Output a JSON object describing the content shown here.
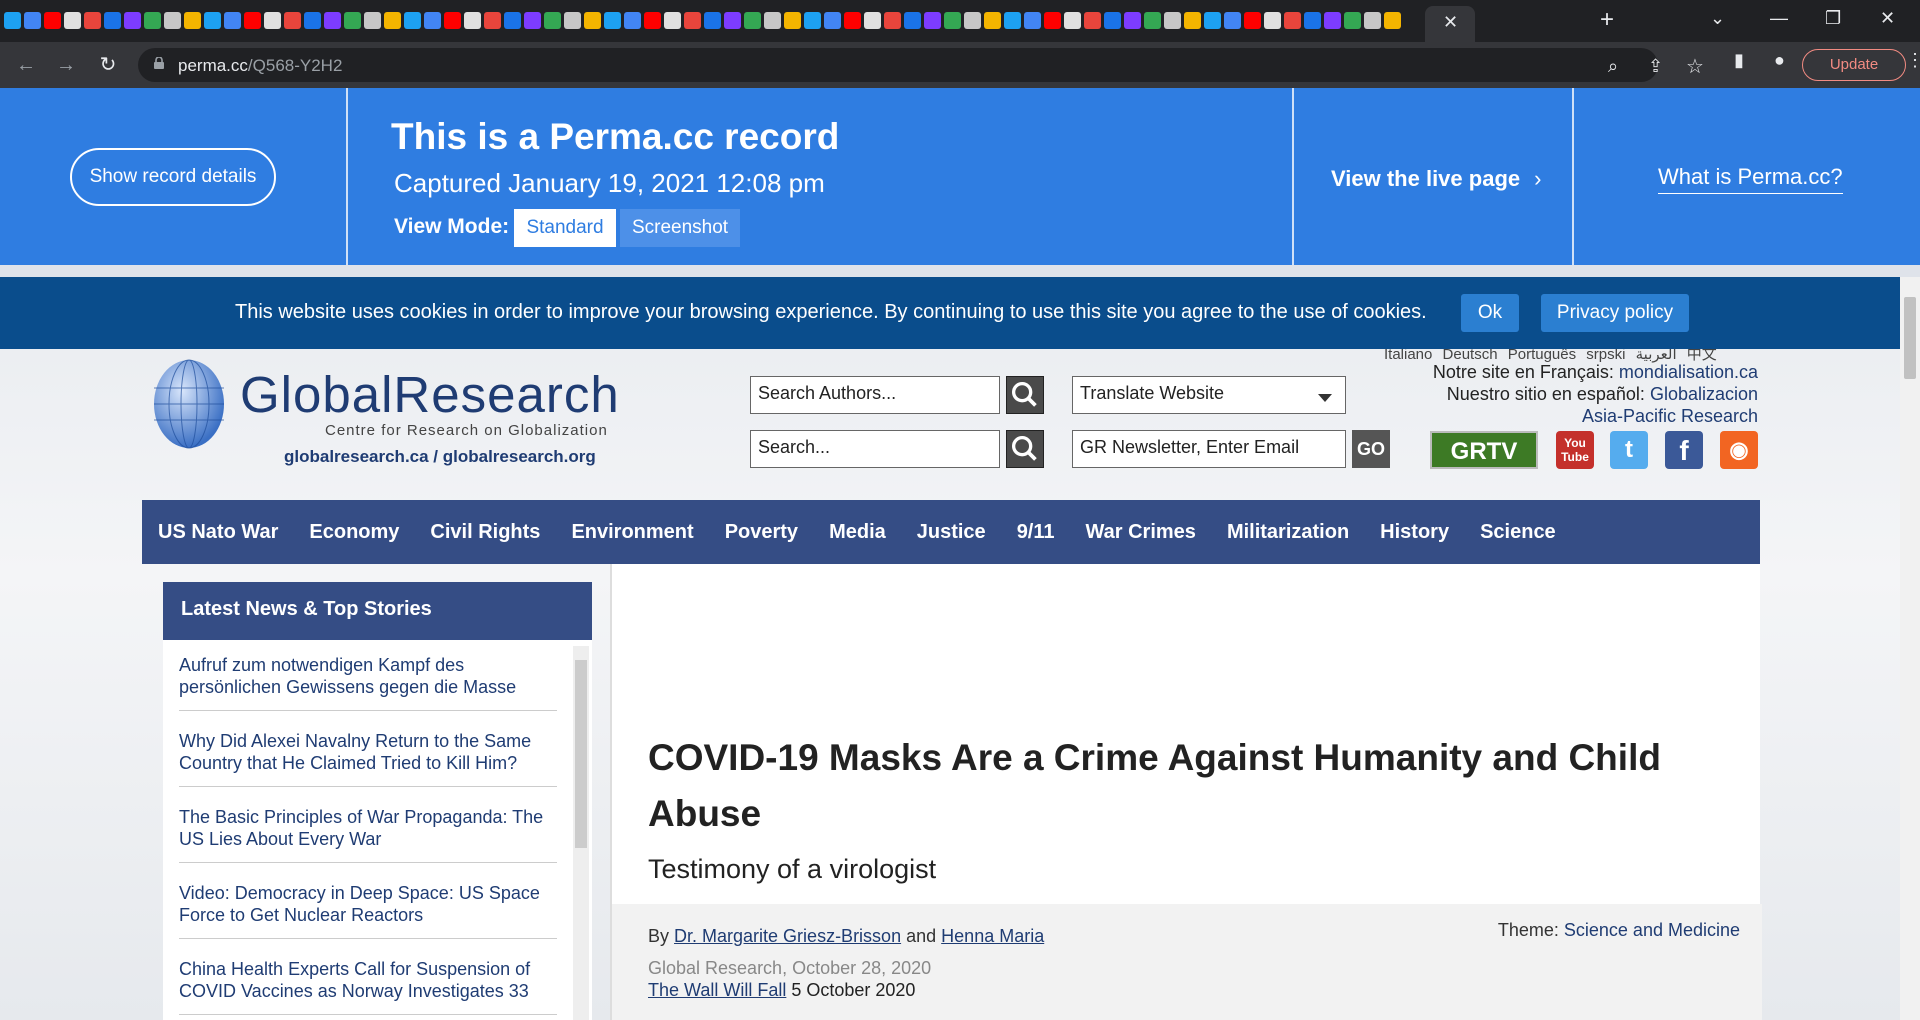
{
  "browser": {
    "url_host": "perma.cc",
    "url_path": "/Q568-Y2H2",
    "update_label": "Update"
  },
  "perma": {
    "show_details": "Show record details",
    "title": "This is a Perma.cc record",
    "captured": "Captured January 19, 2021 12:08 pm",
    "view_mode_label": "View Mode:",
    "mode_standard": "Standard",
    "mode_screenshot": "Screenshot",
    "live_page": "View the live page",
    "what_is": "What is Perma.cc?"
  },
  "cookie": {
    "text": "This website uses cookies in order to improve your browsing experience. By continuing to use this site you agree to the use of cookies.",
    "ok": "Ok",
    "privacy": "Privacy policy"
  },
  "site": {
    "languages": "Italiano  Deutsch  Português  srpski  العربية  中文",
    "logo_word": "GlobalResearch",
    "logo_sub": "Centre for Research on Globalization",
    "logo_url": "globalresearch.ca / globalresearch.org",
    "search_authors": "Search Authors...",
    "search": "Search...",
    "translate": "Translate Website",
    "newsletter": "GR Newsletter, Enter Email",
    "go": "GO",
    "french_label": "Notre site en Français:",
    "french_link": "mondialisation.ca",
    "spanish_label": "Nuestro sitio en español:",
    "spanish_link": "Globalizacion",
    "asia_link": "Asia-Pacific Research",
    "grtv": "GRTV",
    "youtube": "You Tube"
  },
  "nav": [
    "US Nato War",
    "Economy",
    "Civil Rights",
    "Environment",
    "Poverty",
    "Media",
    "Justice",
    "9/11",
    "War Crimes",
    "Militarization",
    "History",
    "Science"
  ],
  "sidebar": {
    "heading": "Latest News & Top Stories",
    "items": [
      "Aufruf zum notwendigen Kampf des persönlichen Gewissens gegen die Masse",
      "Why Did Alexei Navalny Return to the Same Country that He Claimed Tried to Kill Him?",
      "The Basic Principles of War Propaganda: The US Lies About Every War",
      "Video: Democracy in Deep Space: US Space Force to Get Nuclear Reactors",
      "China Health Experts Call for Suspension of COVID Vaccines as Norway Investigates 33"
    ]
  },
  "article": {
    "title": "COVID-19 Masks Are a Crime Against Humanity and Child Abuse",
    "subtitle": "Testimony of a virologist",
    "by": "By",
    "author1": "Dr. Margarite Griesz-Brisson",
    "and": "and",
    "author2": "Henna Maria",
    "theme_label": "Theme:",
    "theme": "Science and Medicine",
    "source": "Global Research, October 28, 2020",
    "orig_source": "The Wall Will Fall",
    "orig_date": "5 October 2020"
  },
  "colors": {
    "perma_blue": "#2f7de1",
    "cookie_blue": "#0a4d8c",
    "nav_blue": "#354d85"
  }
}
